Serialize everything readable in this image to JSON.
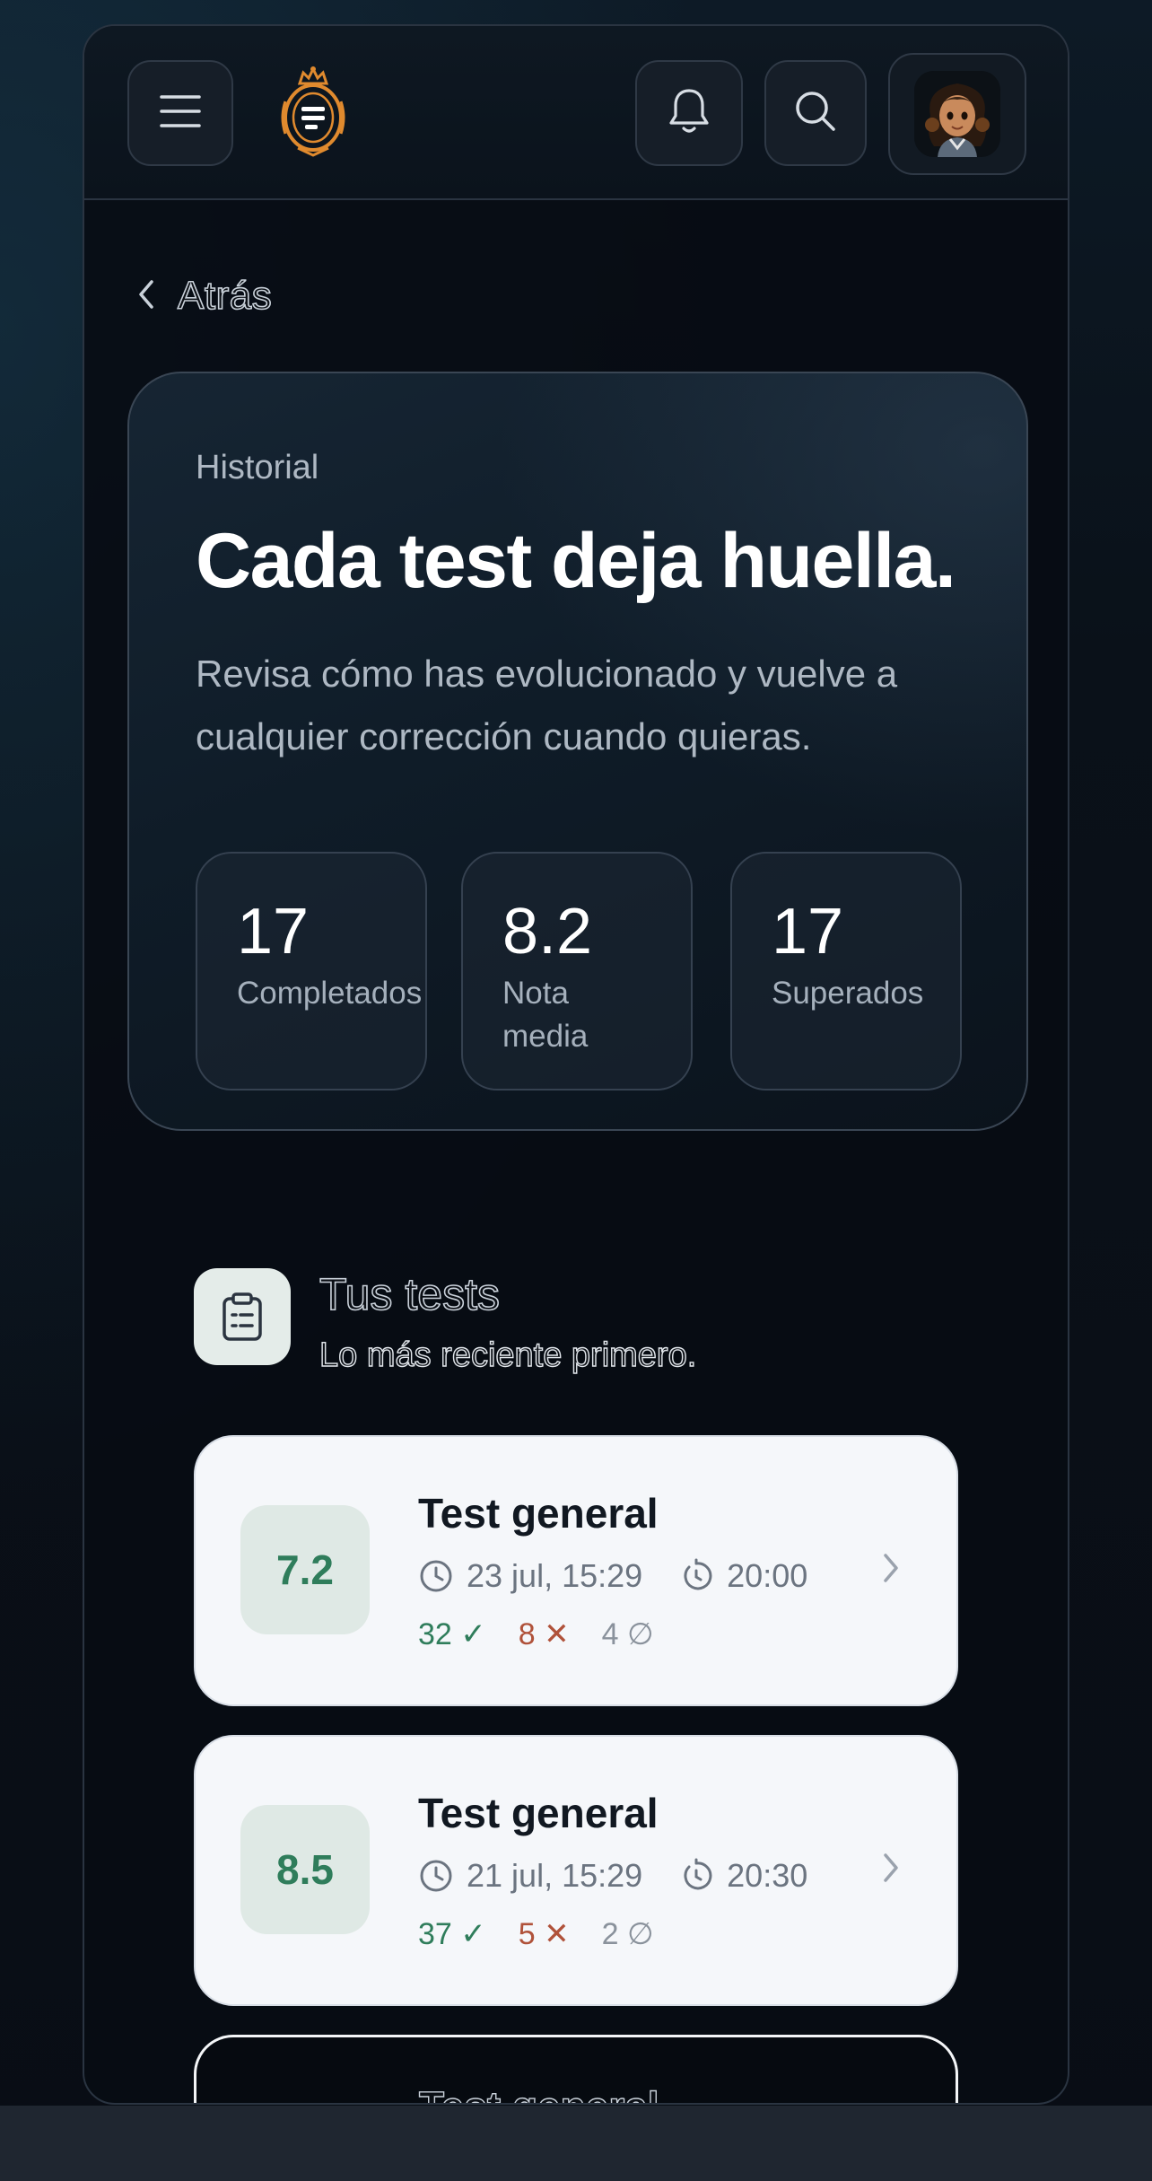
{
  "header": {
    "menu_icon": "menu-icon",
    "logo_icon": "emblem-logo",
    "bell_icon": "bell-icon",
    "search_icon": "search-icon",
    "avatar_icon": "user-avatar"
  },
  "back": {
    "label": "Atrás"
  },
  "hero": {
    "eyebrow": "Historial",
    "title": "Cada test deja huella.",
    "description": "Revisa cómo has evolucionado y vuelve a cualquier corrección cuando quieras.",
    "stats": [
      {
        "value": "17",
        "label": "Completados"
      },
      {
        "value": "8.2",
        "label": "Nota media"
      },
      {
        "value": "17",
        "label": "Superados"
      }
    ]
  },
  "tests_section": {
    "icon": "clipboard-icon",
    "title": "Tus tests",
    "subtitle": "Lo más reciente primero."
  },
  "tests": [
    {
      "score": "7.2",
      "title": "Test general",
      "date": "23 jul, 15:29",
      "duration": "20:00",
      "correct": "32 ✓",
      "wrong": "8 ✕",
      "blank": "4 ∅"
    },
    {
      "score": "8.5",
      "title": "Test general",
      "date": "21 jul, 15:29",
      "duration": "20:30",
      "correct": "37 ✓",
      "wrong": "5 ✕",
      "blank": "2 ∅"
    },
    {
      "title": "Test general"
    }
  ],
  "colors": {
    "accent_green": "#2f7d5b",
    "wrong_red": "#b0523a",
    "card_bg": "#f5f7fa",
    "background": "#0a0f17"
  }
}
